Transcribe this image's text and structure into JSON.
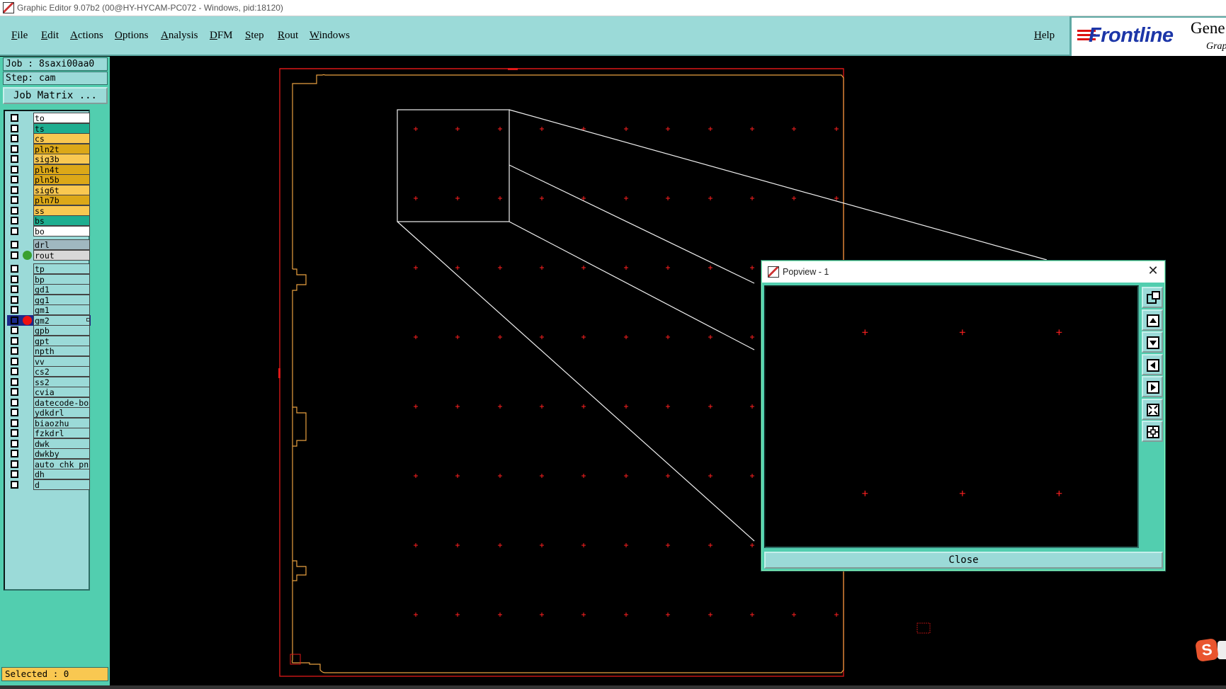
{
  "window": {
    "title": "Graphic Editor 9.07b2 (00@HY-HYCAM-PC072 - Windows, pid:18120)"
  },
  "menubar": {
    "items": [
      "File",
      "Edit",
      "Actions",
      "Options",
      "Analysis",
      "DFM",
      "Step",
      "Rout",
      "Windows"
    ],
    "help": "Help"
  },
  "brand": {
    "logo": "Frontline",
    "gene": "Gene",
    "grap": "Grap"
  },
  "side": {
    "job": "Job : 8saxi00aa0",
    "step": "Step: cam",
    "job_matrix": "Job Matrix ...",
    "selected": "Selected : 0"
  },
  "layers": [
    {
      "name": "to",
      "color": "#ffffff"
    },
    {
      "name": "ts",
      "color": "#1fae90"
    },
    {
      "name": "cs",
      "color": "#f9c851"
    },
    {
      "name": "pln2t",
      "color": "#dca818"
    },
    {
      "name": "sig3b",
      "color": "#f9c851"
    },
    {
      "name": "pln4t",
      "color": "#dca818"
    },
    {
      "name": "pln5b",
      "color": "#dca818"
    },
    {
      "name": "sig6t",
      "color": "#f9c851"
    },
    {
      "name": "pln7b",
      "color": "#dca818"
    },
    {
      "name": "ss",
      "color": "#f9c851"
    },
    {
      "name": "bs",
      "color": "#1fae90"
    },
    {
      "name": "bo",
      "color": "#ffffff"
    },
    {
      "name": "drl",
      "color": "#a0b8c0"
    },
    {
      "name": "rout",
      "color": "#d8d8d8",
      "dot": "#3aa030"
    },
    {
      "name": "tp",
      "color": "#9bdad8"
    },
    {
      "name": "bp",
      "color": "#9bdad8"
    },
    {
      "name": "gd1",
      "color": "#9bdad8"
    },
    {
      "name": "gg1",
      "color": "#9bdad8"
    },
    {
      "name": "gm1",
      "color": "#9bdad8"
    },
    {
      "name": "gm2",
      "color": "#9bdad8",
      "dot": "#ee1111",
      "active": true
    },
    {
      "name": "gpb",
      "color": "#9bdad8"
    },
    {
      "name": "gpt",
      "color": "#9bdad8"
    },
    {
      "name": "npth",
      "color": "#9bdad8"
    },
    {
      "name": "vv",
      "color": "#9bdad8"
    },
    {
      "name": "cs2",
      "color": "#9bdad8"
    },
    {
      "name": "ss2",
      "color": "#9bdad8"
    },
    {
      "name": "cvia",
      "color": "#9bdad8"
    },
    {
      "name": "datecode-bo",
      "color": "#9bdad8"
    },
    {
      "name": "ydkdrl",
      "color": "#9bdad8"
    },
    {
      "name": "biaozhu",
      "color": "#9bdad8"
    },
    {
      "name": "fzkdrl",
      "color": "#9bdad8"
    },
    {
      "name": "dwk",
      "color": "#9bdad8"
    },
    {
      "name": "dwkby",
      "color": "#9bdad8"
    },
    {
      "name": "auto_chk_pnl",
      "color": "#9bdad8"
    },
    {
      "name": "dh",
      "color": "#9bdad8"
    },
    {
      "name": "d",
      "color": "#9bdad8"
    }
  ],
  "popview": {
    "title": "Popview - 1",
    "close_label": "Close",
    "tools": [
      "zoom-window-icon",
      "pan-up-icon",
      "pan-down-icon",
      "pan-left-icon",
      "pan-right-icon",
      "zoom-fit-icon",
      "zoom-center-icon"
    ]
  },
  "colors": {
    "panel": "#52ceaf",
    "menubar": "#9bdad8",
    "profile": "#e01818",
    "outline": "#e8a040",
    "marker": "#ff2020",
    "highlight": "#f9c851",
    "brand_blue": "#1c36a8"
  },
  "tray": {
    "ime_icon": "S"
  }
}
